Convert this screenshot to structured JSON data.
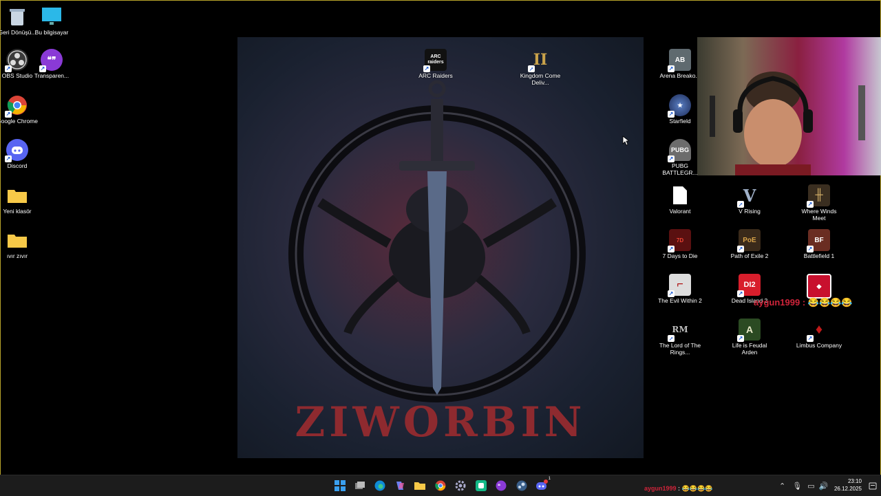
{
  "wallpaper": {
    "title": "ZIWORBIN"
  },
  "desktop_icons_left": [
    {
      "label": "Geri Dönüşü...",
      "icon": "recycle-bin-icon"
    },
    {
      "label": "Bu bilgisayar",
      "icon": "monitor-icon"
    },
    {
      "label": "OBS Studio",
      "icon": "obs-icon"
    },
    {
      "label": "Transparen...",
      "icon": "chat-bubble-icon"
    },
    {
      "label": "Google Chrome",
      "icon": "chrome-icon"
    },
    {
      "label": "Discord",
      "icon": "discord-icon"
    },
    {
      "label": "Yeni klasör",
      "icon": "folder-icon"
    },
    {
      "label": "ıvır zıvır",
      "icon": "folder-icon"
    }
  ],
  "desktop_icons_center": [
    {
      "label": "ARC Raiders",
      "icon": "arc-raiders-icon"
    },
    {
      "label": "Kingdom Come Deliv...",
      "icon": "kingdom-come-icon"
    }
  ],
  "desktop_icons_right": [
    {
      "label": "Arena Breako...",
      "icon": "arena-breakout-icon"
    },
    {
      "label": "Starfield",
      "icon": "starfield-icon"
    },
    {
      "label": "PUBG BATTLEGR...",
      "icon": "pubg-icon"
    },
    {
      "label": "Valorant",
      "icon": "file-icon"
    },
    {
      "label": "V Rising",
      "icon": "v-rising-icon"
    },
    {
      "label": "Where Winds Meet",
      "icon": "where-winds-meet-icon"
    },
    {
      "label": "7 Days to Die",
      "icon": "seven-days-icon"
    },
    {
      "label": "Path of Exile 2",
      "icon": "poe-icon"
    },
    {
      "label": "Battlefield 1",
      "icon": "battlefield-icon"
    },
    {
      "label": "The Evil Within 2",
      "icon": "evil-within-icon"
    },
    {
      "label": "Dead Island 2",
      "icon": "dead-island-icon"
    },
    {
      "label": "The Lord of The Rings...",
      "icon": "lotr-icon"
    },
    {
      "label": "Life is Feudal Arden",
      "icon": "life-is-feudal-icon"
    },
    {
      "label": "Limbus Company",
      "icon": "limbus-icon"
    }
  ],
  "chat_overlay": {
    "user": "aygun1999",
    "separator": " : ",
    "emotes": "😂😂😂😂"
  },
  "taskbar": {
    "chat_user": "aygun1999",
    "chat_separator": " : ",
    "chat_emotes": "😂😂😂😂",
    "time": "23:10",
    "date": "26.12.2025",
    "discord_badge": "1"
  },
  "colors": {
    "accent": "#b8a42a",
    "chat": "#d0243a",
    "taskbar": "#1c1c1c"
  }
}
